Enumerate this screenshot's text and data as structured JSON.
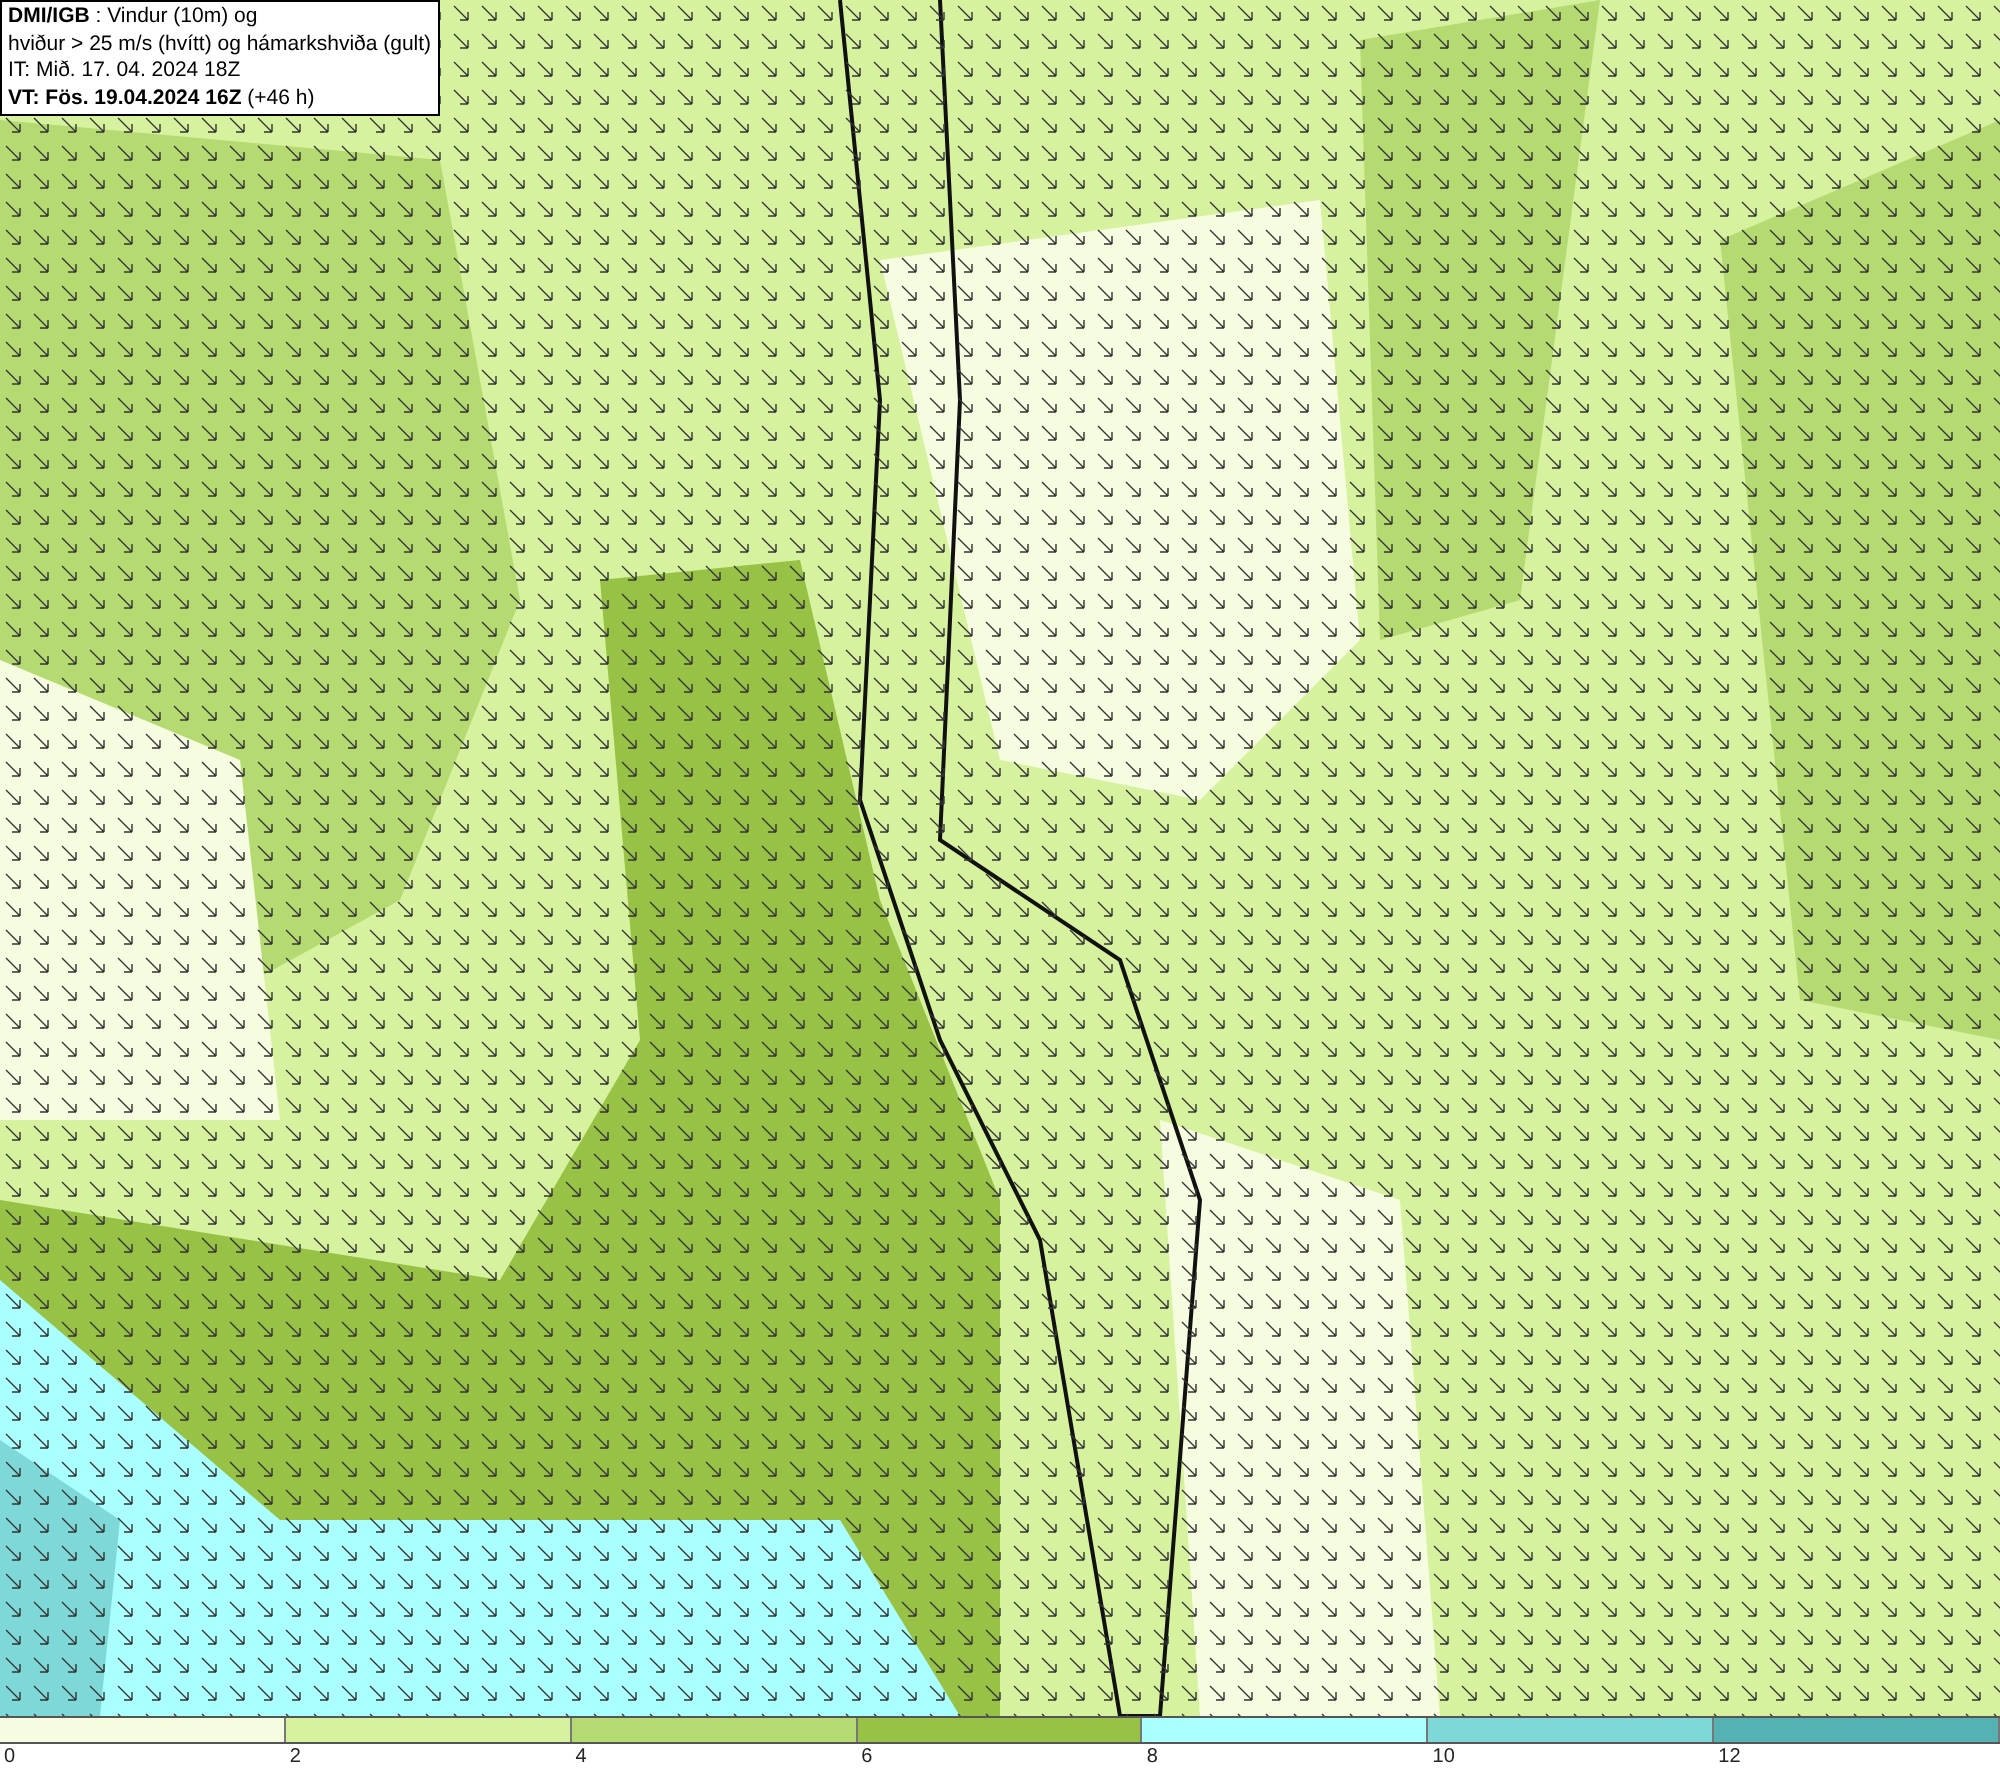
{
  "title_box": {
    "lines": [
      "**DMI/IGB** : Vindur (10m) og",
      "hviður > 25 m/s (hvítt) og hámarkshviða (gult)",
      "IT: Mið. 17. 04. 2024 18Z",
      "**VT: Fös. 19.04.2024 16Z** (+46 h)"
    ]
  },
  "legend": {
    "segments": [
      {
        "color": "#f5fce0"
      },
      {
        "color": "#d6f29e"
      },
      {
        "color": "#b5da72"
      },
      {
        "color": "#97c245"
      },
      {
        "color": "#aaffff"
      },
      {
        "color": "#7fd8d8"
      },
      {
        "color": "#55b2b2"
      }
    ],
    "ticks": [
      "0",
      "2",
      "4",
      "6",
      "8",
      "10",
      "12"
    ]
  }
}
